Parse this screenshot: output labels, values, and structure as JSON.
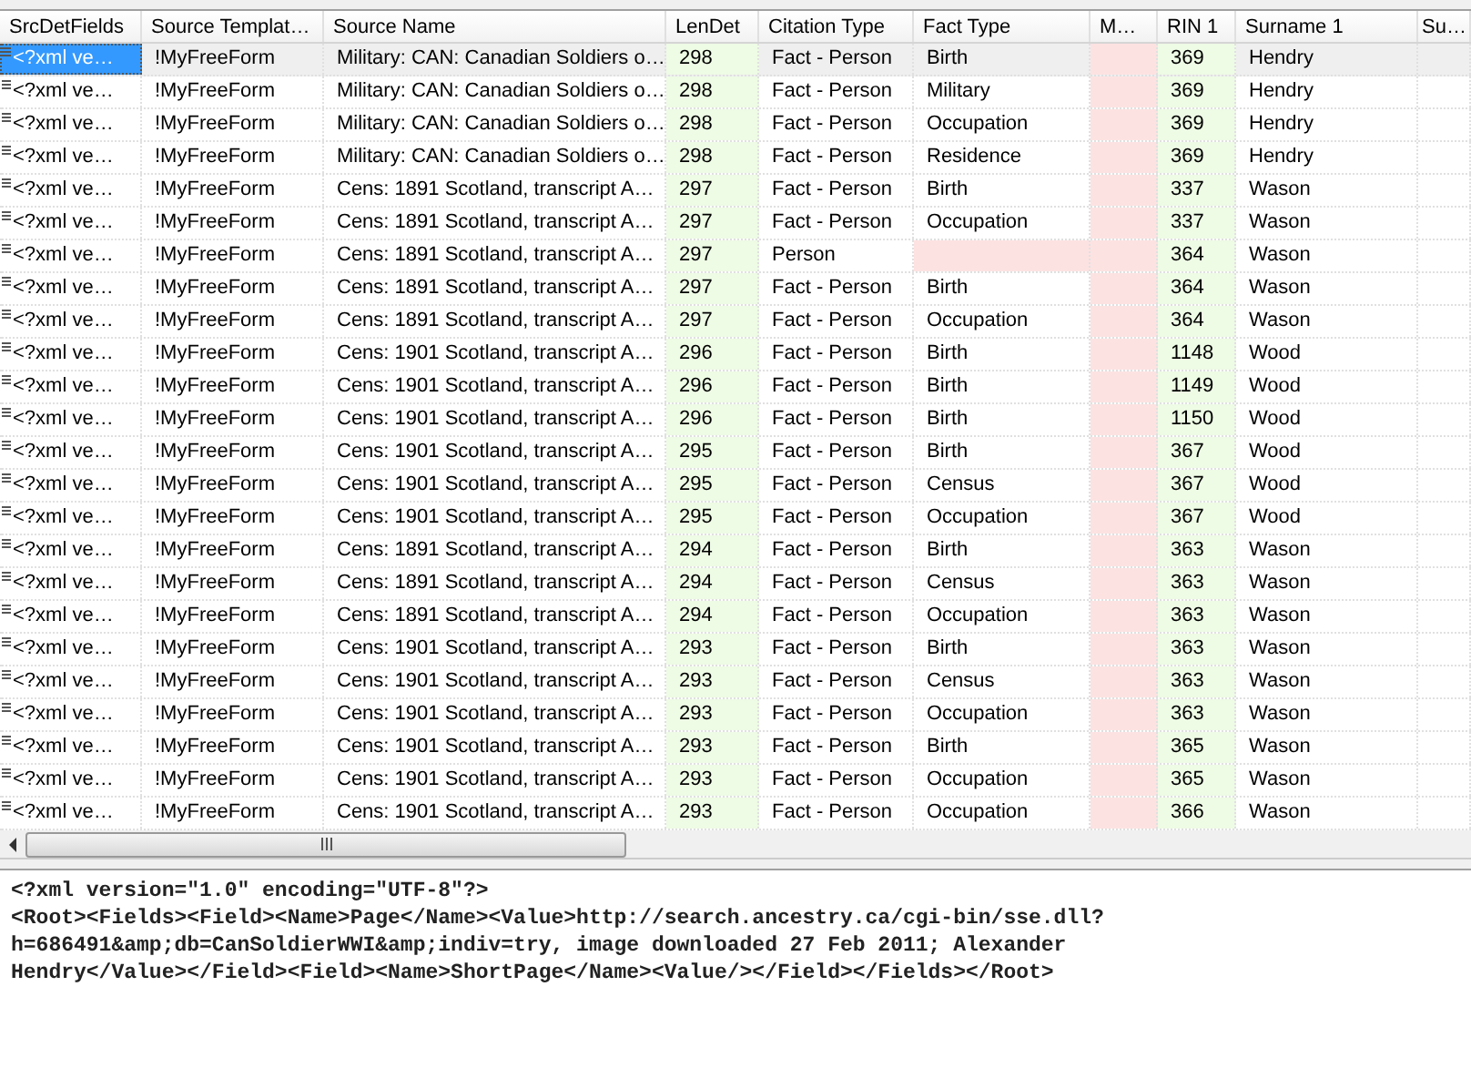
{
  "table": {
    "columns": [
      {
        "label": "SrcDetFields"
      },
      {
        "label": "Source Templat…"
      },
      {
        "label": "Source Name"
      },
      {
        "label": "LenDet",
        "color": "#eefbe5"
      },
      {
        "label": "Citation Type"
      },
      {
        "label": "Fact Type",
        "flag_empty": true
      },
      {
        "label": "M…",
        "color": "#fde2e2"
      },
      {
        "label": "RIN 1",
        "color": "#eefbe5"
      },
      {
        "label": "Surname 1"
      },
      {
        "label": "Su…"
      }
    ],
    "rows": [
      {
        "selected": true,
        "cells": [
          "<?xml ve…",
          "!MyFreeForm",
          "Military: CAN: Canadian Soldiers o…",
          "298",
          "Fact - Person",
          "Birth",
          null,
          "369",
          "Hendry",
          null
        ]
      },
      {
        "selected": false,
        "cells": [
          "<?xml ve…",
          "!MyFreeForm",
          "Military: CAN: Canadian Soldiers o…",
          "298",
          "Fact - Person",
          "Military",
          null,
          "369",
          "Hendry",
          null
        ]
      },
      {
        "selected": false,
        "cells": [
          "<?xml ve…",
          "!MyFreeForm",
          "Military: CAN: Canadian Soldiers o…",
          "298",
          "Fact - Person",
          "Occupation",
          null,
          "369",
          "Hendry",
          null
        ]
      },
      {
        "selected": false,
        "cells": [
          "<?xml ve…",
          "!MyFreeForm",
          "Military: CAN: Canadian Soldiers o…",
          "298",
          "Fact - Person",
          "Residence",
          null,
          "369",
          "Hendry",
          null
        ]
      },
      {
        "selected": false,
        "cells": [
          "<?xml ve…",
          "!MyFreeForm",
          "Cens: 1891 Scotland, transcript A…",
          "297",
          "Fact - Person",
          "Birth",
          null,
          "337",
          "Wason",
          null
        ]
      },
      {
        "selected": false,
        "cells": [
          "<?xml ve…",
          "!MyFreeForm",
          "Cens: 1891 Scotland, transcript A…",
          "297",
          "Fact - Person",
          "Occupation",
          null,
          "337",
          "Wason",
          null
        ]
      },
      {
        "selected": false,
        "cells": [
          "<?xml ve…",
          "!MyFreeForm",
          "Cens: 1891 Scotland, transcript A…",
          "297",
          "Person",
          null,
          null,
          "364",
          "Wason",
          null
        ]
      },
      {
        "selected": false,
        "cells": [
          "<?xml ve…",
          "!MyFreeForm",
          "Cens: 1891 Scotland, transcript A…",
          "297",
          "Fact - Person",
          "Birth",
          null,
          "364",
          "Wason",
          null
        ]
      },
      {
        "selected": false,
        "cells": [
          "<?xml ve…",
          "!MyFreeForm",
          "Cens: 1891 Scotland, transcript A…",
          "297",
          "Fact - Person",
          "Occupation",
          null,
          "364",
          "Wason",
          null
        ]
      },
      {
        "selected": false,
        "cells": [
          "<?xml ve…",
          "!MyFreeForm",
          "Cens: 1901 Scotland, transcript A…",
          "296",
          "Fact - Person",
          "Birth",
          null,
          "1148",
          "Wood",
          null
        ]
      },
      {
        "selected": false,
        "cells": [
          "<?xml ve…",
          "!MyFreeForm",
          "Cens: 1901 Scotland, transcript A…",
          "296",
          "Fact - Person",
          "Birth",
          null,
          "1149",
          "Wood",
          null
        ]
      },
      {
        "selected": false,
        "cells": [
          "<?xml ve…",
          "!MyFreeForm",
          "Cens: 1901 Scotland, transcript A…",
          "296",
          "Fact - Person",
          "Birth",
          null,
          "1150",
          "Wood",
          null
        ]
      },
      {
        "selected": false,
        "cells": [
          "<?xml ve…",
          "!MyFreeForm",
          "Cens: 1901 Scotland, transcript A…",
          "295",
          "Fact - Person",
          "Birth",
          null,
          "367",
          "Wood",
          null
        ]
      },
      {
        "selected": false,
        "cells": [
          "<?xml ve…",
          "!MyFreeForm",
          "Cens: 1901 Scotland, transcript A…",
          "295",
          "Fact - Person",
          "Census",
          null,
          "367",
          "Wood",
          null
        ]
      },
      {
        "selected": false,
        "cells": [
          "<?xml ve…",
          "!MyFreeForm",
          "Cens: 1901 Scotland, transcript A…",
          "295",
          "Fact - Person",
          "Occupation",
          null,
          "367",
          "Wood",
          null
        ]
      },
      {
        "selected": false,
        "cells": [
          "<?xml ve…",
          "!MyFreeForm",
          "Cens: 1891 Scotland, transcript A…",
          "294",
          "Fact - Person",
          "Birth",
          null,
          "363",
          "Wason",
          null
        ]
      },
      {
        "selected": false,
        "cells": [
          "<?xml ve…",
          "!MyFreeForm",
          "Cens: 1891 Scotland, transcript A…",
          "294",
          "Fact - Person",
          "Census",
          null,
          "363",
          "Wason",
          null
        ]
      },
      {
        "selected": false,
        "cells": [
          "<?xml ve…",
          "!MyFreeForm",
          "Cens: 1891 Scotland, transcript A…",
          "294",
          "Fact - Person",
          "Occupation",
          null,
          "363",
          "Wason",
          null
        ]
      },
      {
        "selected": false,
        "cells": [
          "<?xml ve…",
          "!MyFreeForm",
          "Cens: 1901 Scotland, transcript A…",
          "293",
          "Fact - Person",
          "Birth",
          null,
          "363",
          "Wason",
          null
        ]
      },
      {
        "selected": false,
        "cells": [
          "<?xml ve…",
          "!MyFreeForm",
          "Cens: 1901 Scotland, transcript A…",
          "293",
          "Fact - Person",
          "Census",
          null,
          "363",
          "Wason",
          null
        ]
      },
      {
        "selected": false,
        "cells": [
          "<?xml ve…",
          "!MyFreeForm",
          "Cens: 1901 Scotland, transcript A…",
          "293",
          "Fact - Person",
          "Occupation",
          null,
          "363",
          "Wason",
          null
        ]
      },
      {
        "selected": false,
        "cells": [
          "<?xml ve…",
          "!MyFreeForm",
          "Cens: 1901 Scotland, transcript A…",
          "293",
          "Fact - Person",
          "Birth",
          null,
          "365",
          "Wason",
          null
        ]
      },
      {
        "selected": false,
        "cells": [
          "<?xml ve…",
          "!MyFreeForm",
          "Cens: 1901 Scotland, transcript A…",
          "293",
          "Fact - Person",
          "Occupation",
          null,
          "365",
          "Wason",
          null
        ]
      },
      {
        "selected": false,
        "cells": [
          "<?xml ve…",
          "!MyFreeForm",
          "Cens: 1901 Scotland, transcript A…",
          "293",
          "Fact - Person",
          "Occupation",
          null,
          "366",
          "Wason",
          null
        ]
      }
    ]
  },
  "detail": {
    "lines": [
      "<?xml version=\"1.0\" encoding=\"UTF-8\"?>",
      "<Root><Fields><Field><Name>Page</Name><Value>http://search.ancestry.ca/cgi-bin/sse.dll?",
      "h=686491&amp;db=CanSoldierWWI&amp;indiv=try, image downloaded 27 Feb 2011; Alexander",
      "Hendry</Value></Field><Field><Name>ShortPage</Name><Value/></Field></Fields></Root>"
    ]
  }
}
